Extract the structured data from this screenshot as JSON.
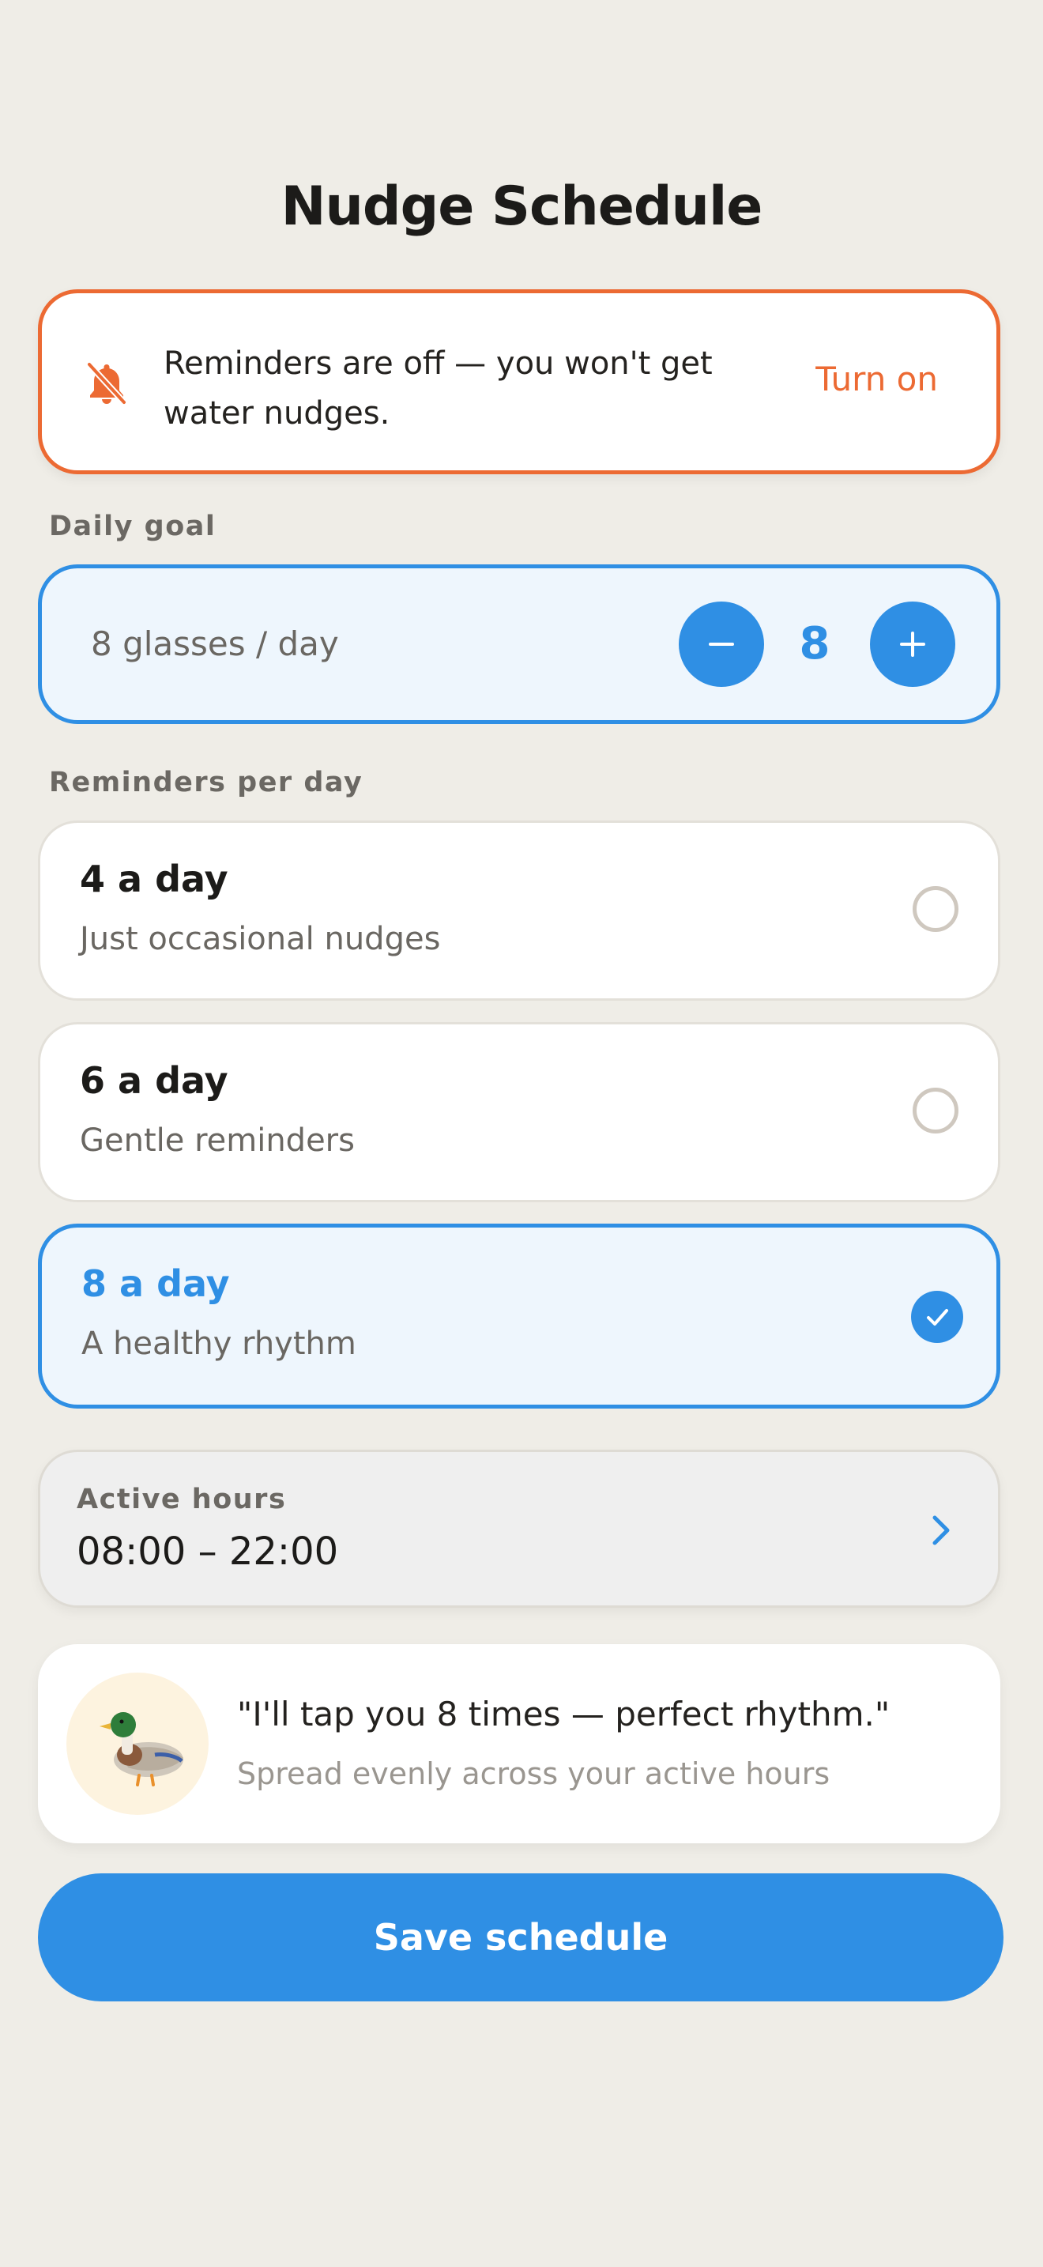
{
  "header": {
    "title": "Nudge Schedule"
  },
  "banner": {
    "icon": "bell-off-icon",
    "message": "Reminders are off — you won't get water nudges.",
    "action_label": "Turn on",
    "accent_color": "#ec6a33"
  },
  "daily_goal": {
    "section_label": "Daily goal",
    "summary": "8 glasses / day",
    "value": "8",
    "decrement_icon": "minus-icon",
    "increment_icon": "plus-icon"
  },
  "reminders": {
    "section_label": "Reminders per day",
    "options": [
      {
        "title": "4 a day",
        "subtitle": "Just occasional nudges",
        "selected": false
      },
      {
        "title": "6 a day",
        "subtitle": "Gentle reminders",
        "selected": false
      },
      {
        "title": "8 a day",
        "subtitle": "A healthy rhythm",
        "selected": true
      }
    ]
  },
  "active_hours": {
    "label": "Active hours",
    "value": "08:00 – 22:00",
    "icon": "chevron-right-icon"
  },
  "mascot": {
    "icon": "duck-icon",
    "quote": "\"I'll tap you 8 times — perfect rhythm.\"",
    "subtext": "Spread evenly across your active hours"
  },
  "save_button": {
    "label": "Save schedule"
  },
  "colors": {
    "primary": "#2f8fe4",
    "warning": "#ec6a33",
    "background": "#efede7"
  }
}
